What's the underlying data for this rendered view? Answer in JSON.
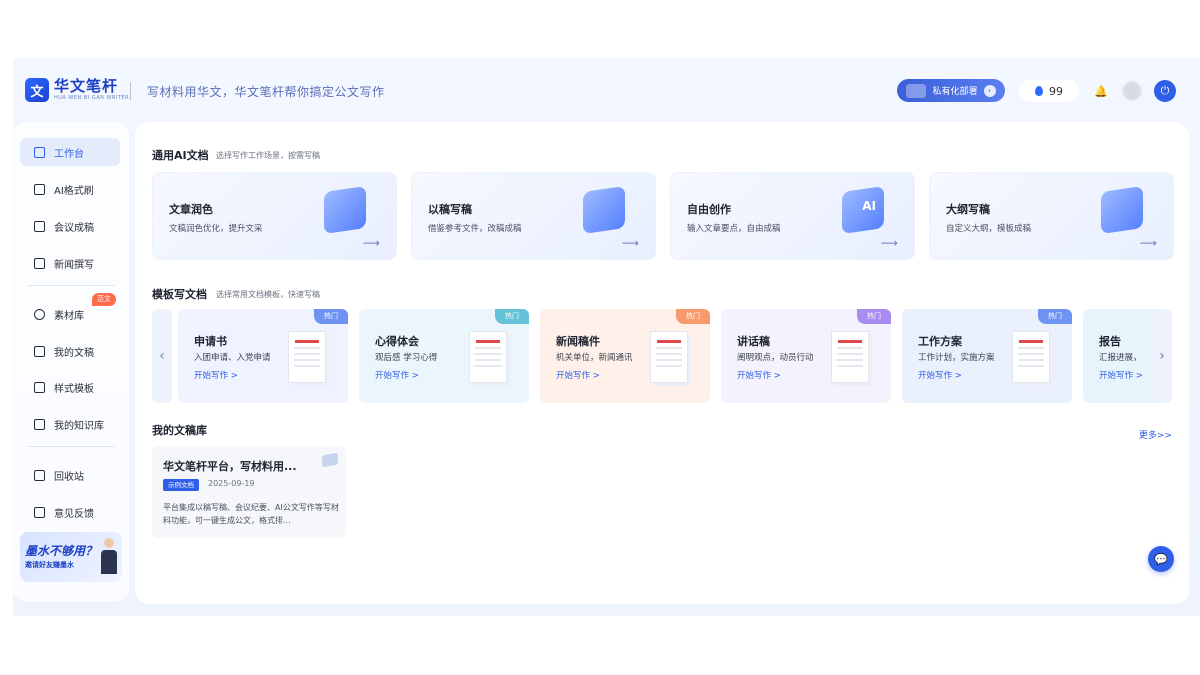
{
  "header": {
    "logo_mark": "文",
    "logo_name": "华文笔杆",
    "logo_sub": "HUA WEN BI GAN WRITER",
    "slogan": "写材料用华文，华文笔杆帮你搞定公文写作",
    "deploy_label": "私有化部署",
    "credits": "99"
  },
  "sidebar": {
    "items": [
      {
        "label": "工作台",
        "icon": "folder-icon",
        "active": true
      },
      {
        "label": "AI格式刷",
        "icon": "document-icon"
      },
      {
        "label": "会议成稿",
        "icon": "file-text-icon"
      },
      {
        "label": "新闻撰写",
        "icon": "newspaper-icon"
      },
      {
        "label": "素材库",
        "icon": "globe-icon",
        "badge": "范文"
      },
      {
        "label": "我的文稿",
        "icon": "clipboard-icon"
      },
      {
        "label": "样式模板",
        "icon": "template-icon"
      },
      {
        "label": "我的知识库",
        "icon": "book-icon"
      },
      {
        "label": "回收站",
        "icon": "trash-icon"
      },
      {
        "label": "意见反馈",
        "icon": "mail-icon"
      }
    ],
    "promo": {
      "title": "墨水不够用？",
      "subtitle": "邀请好友赚墨水"
    }
  },
  "main": {
    "ai_section": {
      "title": "通用AI文档",
      "subtitle": "选择写作工作场景，按需写稿",
      "cards": [
        {
          "title": "文章润色",
          "desc": "文稿润色优化，提升文采"
        },
        {
          "title": "以稿写稿",
          "desc": "借鉴参考文件，改稿成稿"
        },
        {
          "title": "自由创作",
          "desc": "输入文章要点，自由成稿",
          "ill_text": "AI"
        },
        {
          "title": "大纲写稿",
          "desc": "自定义大纲，模板成稿"
        }
      ]
    },
    "template_section": {
      "title": "模板写文档",
      "subtitle": "选择常用文档模板，快速写稿",
      "go_label": "开始写作 >",
      "hot_label": "热门",
      "cards": [
        {
          "title": "申请书",
          "desc": "入团申请、入党申请",
          "bg": "#eef3ff",
          "hot": "#6f93f2"
        },
        {
          "title": "心得体会",
          "desc": "观后感 学习心得",
          "bg": "#eaf6fb",
          "hot": "#66c2d8"
        },
        {
          "title": "新闻稿件",
          "desc": "机关单位，新闻通讯",
          "bg": "#fff1ea",
          "hot": "#f79a6e"
        },
        {
          "title": "讲话稿",
          "desc": "阐明观点，动员行动",
          "bg": "#f4f2fd",
          "hot": "#a88cf0"
        },
        {
          "title": "工作方案",
          "desc": "工作计划，实施方案",
          "bg": "#eaf1fd",
          "hot": "#6f93f2"
        },
        {
          "title": "报告",
          "desc": "汇报进展，",
          "bg": "#e8f4fc",
          "hot": "#66c2d8"
        }
      ]
    },
    "library_section": {
      "title": "我的文稿库",
      "more_label": "更多>>",
      "docs": [
        {
          "title": "华文笔杆平台，写材料用...",
          "tag": "示例文档",
          "date": "2025-09-19",
          "desc": "平台集成以稿写稿、会议纪要、AI公文写作等写材料功能，可一键生成公文，格式排..."
        }
      ]
    }
  },
  "colors": {
    "accent": "#2f5ee8",
    "brand": "#1d3fc4",
    "badge": "#ff6b4a"
  }
}
